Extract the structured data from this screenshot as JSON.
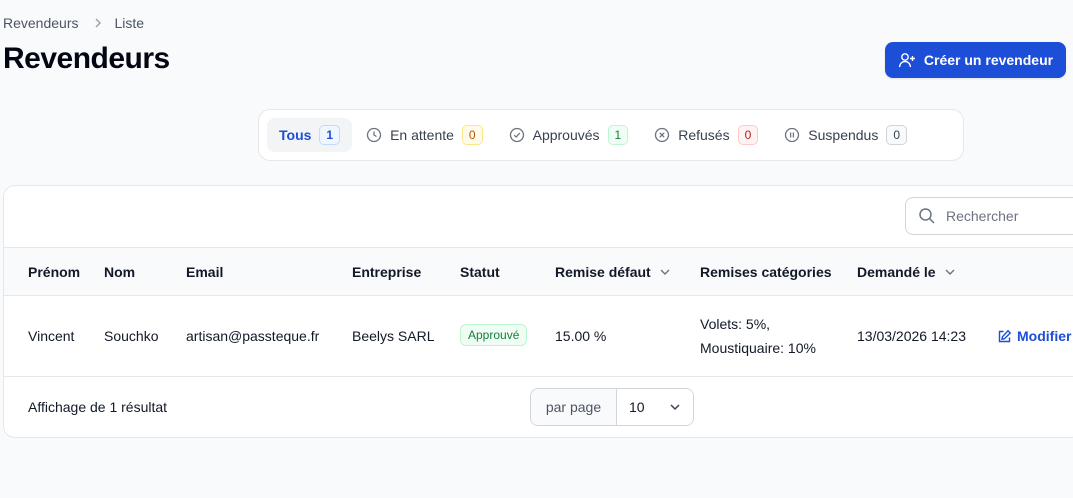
{
  "breadcrumb": [
    "Revendeurs",
    "Liste"
  ],
  "page_title": "Revendeurs",
  "create_button": "Créer un revendeur",
  "tabs": [
    {
      "label": "Tous",
      "count": "1",
      "icon": "none"
    },
    {
      "label": "En attente",
      "count": "0",
      "icon": "clock-icon"
    },
    {
      "label": "Approuvés",
      "count": "1",
      "icon": "check-circle-icon"
    },
    {
      "label": "Refusés",
      "count": "0",
      "icon": "x-circle-icon"
    },
    {
      "label": "Suspendus",
      "count": "0",
      "icon": "pause-circle-icon"
    }
  ],
  "search": {
    "placeholder": "Rechercher"
  },
  "table": {
    "headers": [
      "Prénom",
      "Nom",
      "Email",
      "Entreprise",
      "Statut",
      "Remise défaut",
      "Remises catégories",
      "Demandé le"
    ],
    "rows": [
      {
        "prenom": "Vincent",
        "nom": "Souchko",
        "email": "artisan@passteque.fr",
        "entreprise": "Beelys SARL",
        "statut": "Approuvé",
        "remise": "15.00 %",
        "categories_line1": "Volets: 5%,",
        "categories_line2": "Moustiquaire: 10%",
        "date": "13/03/2026 14:23",
        "action": "Modifier"
      }
    ]
  },
  "footer": {
    "summary": "Affichage de 1 résultat",
    "per_page_label": "par page",
    "per_page_value": "10"
  },
  "colors": {
    "accent": "#1d4ed8",
    "success": "#15803d"
  }
}
